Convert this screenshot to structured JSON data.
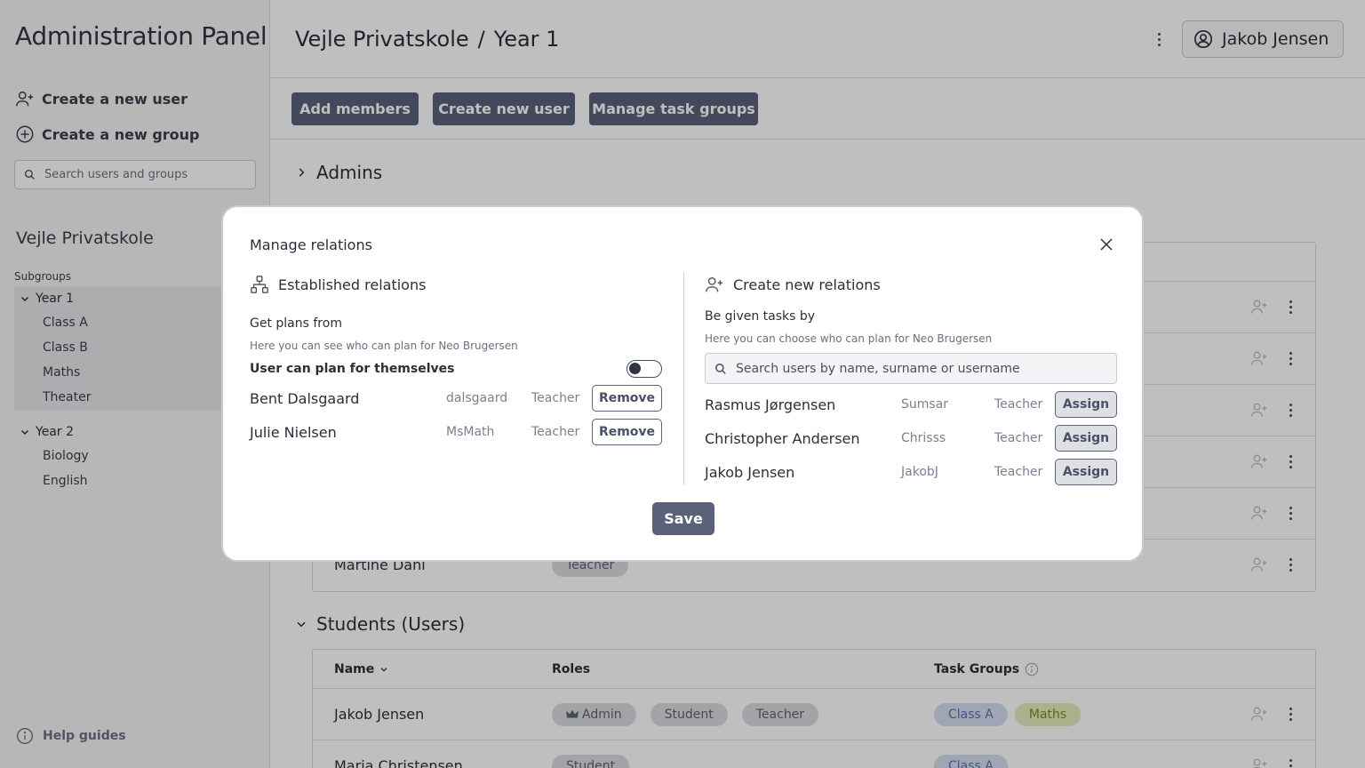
{
  "sidebar": {
    "app_title": "Administration Panel",
    "create_user": "Create a new user",
    "create_group": "Create a new group",
    "search_placeholder": "Search users and groups",
    "org_name": "Vejle Privatskole",
    "subgroups_label": "Subgroups",
    "groups": [
      {
        "label": "Year 1",
        "children": [
          "Class A",
          "Class B",
          "Maths",
          "Theater"
        ]
      },
      {
        "label": "Year 2",
        "children": [
          "Biology",
          "English"
        ]
      }
    ],
    "help": "Help guides"
  },
  "header": {
    "breadcrumb": [
      "Vejle Privatskole",
      "/",
      "Year 1"
    ],
    "user": "Jakob Jensen"
  },
  "toolbar": {
    "add_members": "Add members",
    "create_new_user": "Create new user",
    "manage_task_groups": "Manage task groups"
  },
  "sections": {
    "admins": "Admins",
    "teachers_last_name": "Martine Dahl",
    "teachers_last_role": "Teacher",
    "students": "Students (Users)"
  },
  "students_table": {
    "columns": {
      "name": "Name",
      "roles": "Roles",
      "task_groups": "Task Groups"
    },
    "rows": [
      {
        "name": "Jakob Jensen",
        "roles": [
          "Admin",
          "Student",
          "Teacher"
        ],
        "task_groups": [
          "Class A",
          "Maths"
        ]
      },
      {
        "name": "Maria Christensen",
        "roles": [
          "Student"
        ],
        "task_groups": [
          "Class A"
        ]
      }
    ]
  },
  "modal": {
    "title": "Manage relations",
    "established": {
      "heading": "Established relations",
      "sub_title": "Get plans from",
      "desc": "Here you can see who can plan for Neo Brugersen",
      "self_label": "User can plan for themselves",
      "self_enabled": false,
      "remove_label": "Remove",
      "relations": [
        {
          "name": "Bent Dalsgaard",
          "username": "dalsgaard",
          "role": "Teacher"
        },
        {
          "name": "Julie Nielsen",
          "username": "MsMath",
          "role": "Teacher"
        }
      ]
    },
    "create": {
      "heading": "Create new relations",
      "sub_title": "Be given tasks by",
      "desc": "Here you can choose who can plan for Neo Brugersen",
      "search_placeholder": "Search users by name, surname or username",
      "assign_label": "Assign",
      "candidates": [
        {
          "name": "Rasmus Jørgensen",
          "username": "Sumsar",
          "role": "Teacher"
        },
        {
          "name": "Christopher Andersen",
          "username": "Chrisss",
          "role": "Teacher"
        },
        {
          "name": "Jakob Jensen",
          "username": "JakobJ",
          "role": "Teacher"
        }
      ]
    },
    "save_label": "Save"
  },
  "colors": {
    "primary": "#5a6178",
    "overlay": "rgba(0,0,0,0.25)",
    "pill_blue": "#d4ddee",
    "pill_green": "#e6ebbd"
  }
}
